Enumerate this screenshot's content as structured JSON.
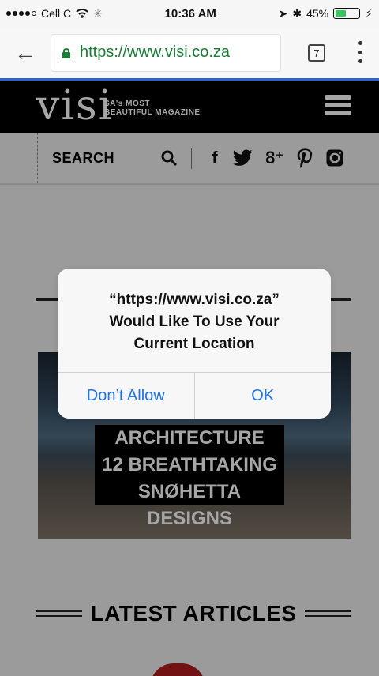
{
  "status": {
    "carrier": "Cell C",
    "time": "10:36 AM",
    "battery_percent": "45%",
    "battery_level": 0.45
  },
  "browser": {
    "url_text": "https://www.visi.co.za",
    "tabs_count": "7"
  },
  "site": {
    "logo_text": "visi",
    "tagline_line1": "SA's MOST",
    "tagline_line2": "BEAUTIFUL MAGAZINE",
    "search_label": "SEARCH"
  },
  "alert": {
    "title_lines": [
      "“https://www.visi.co.za”",
      "Would Like To Use Your",
      "Current Location"
    ],
    "deny_label": "Don’t Allow",
    "ok_label": "OK"
  },
  "content": {
    "featured_title_lines": [
      "ARCHITECTURE LOVE:",
      "12 BREATHTAKING",
      "SNØHETTA DESIGNS"
    ],
    "latest_heading": "LATEST ARTICLES"
  },
  "colors": {
    "accent_link": "#1e73f0",
    "ssl_green": "#1a7f36",
    "header_black": "#000000"
  }
}
